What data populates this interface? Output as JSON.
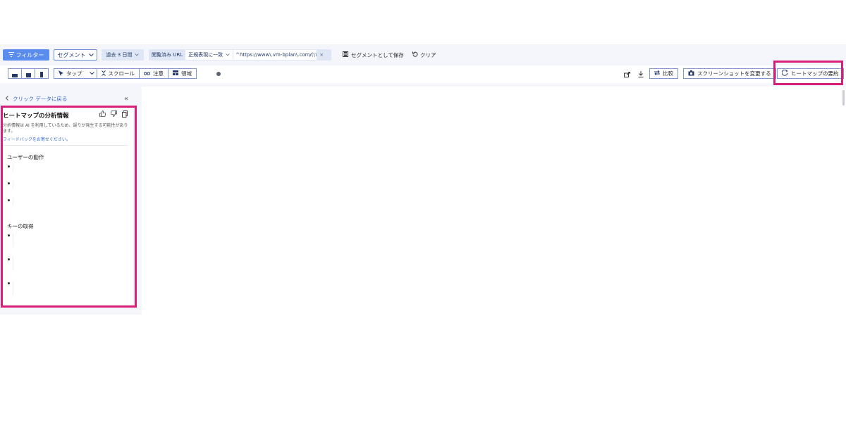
{
  "filterbar": {
    "filter_label": "フィルター",
    "segment_label": "セグメント",
    "date_label": "過去 3 日間",
    "url_chip": {
      "key": "閲覧済み URL",
      "operator": "正規表現に一致",
      "value": "^https://www\\.vm-bplan\\.com/(\\?.*)?$",
      "remove": "×"
    },
    "save_segment_label": "セグメントとして保存",
    "clear_label": "クリア"
  },
  "toolbar": {
    "modes": [
      {
        "label": "タップ"
      },
      {
        "label": "スクロール"
      },
      {
        "label": "注意"
      },
      {
        "label": "領域"
      }
    ],
    "compare_label": "比較",
    "screenshot_label": "スクリーンショットを変更する",
    "summary_label": "ヒートマップの要約"
  },
  "left_panel": {
    "back_label": "クリック データに戻る",
    "collapse_glyph": "«",
    "card": {
      "title": "ヒートマップの分析情報",
      "note": "分析情報は AI を利用しているため、誤りが発生する可能性があります。",
      "feedback_link": "フィードバックをお寄せください。",
      "sections": [
        {
          "heading": "ユーザーの動作"
        },
        {
          "heading": "キーの取得"
        }
      ]
    }
  },
  "colors": {
    "accent": "#5b8def",
    "highlight": "#d81e78",
    "link": "#3568c9",
    "chip_bg": "#dfe6f5"
  },
  "icons": [
    "filter-icon",
    "chevron-down-icon",
    "save-icon",
    "refresh-icon",
    "desktop-icon",
    "tablet-icon",
    "mobile-icon",
    "cursor-icon",
    "scroll-icon",
    "eyes-icon",
    "grid-icon",
    "info-icon",
    "share-icon",
    "download-icon",
    "compare-icon",
    "camera-icon",
    "ai-sparkle-icon",
    "chevron-left-icon",
    "thumbs-up-icon",
    "thumbs-down-icon",
    "copy-icon"
  ]
}
